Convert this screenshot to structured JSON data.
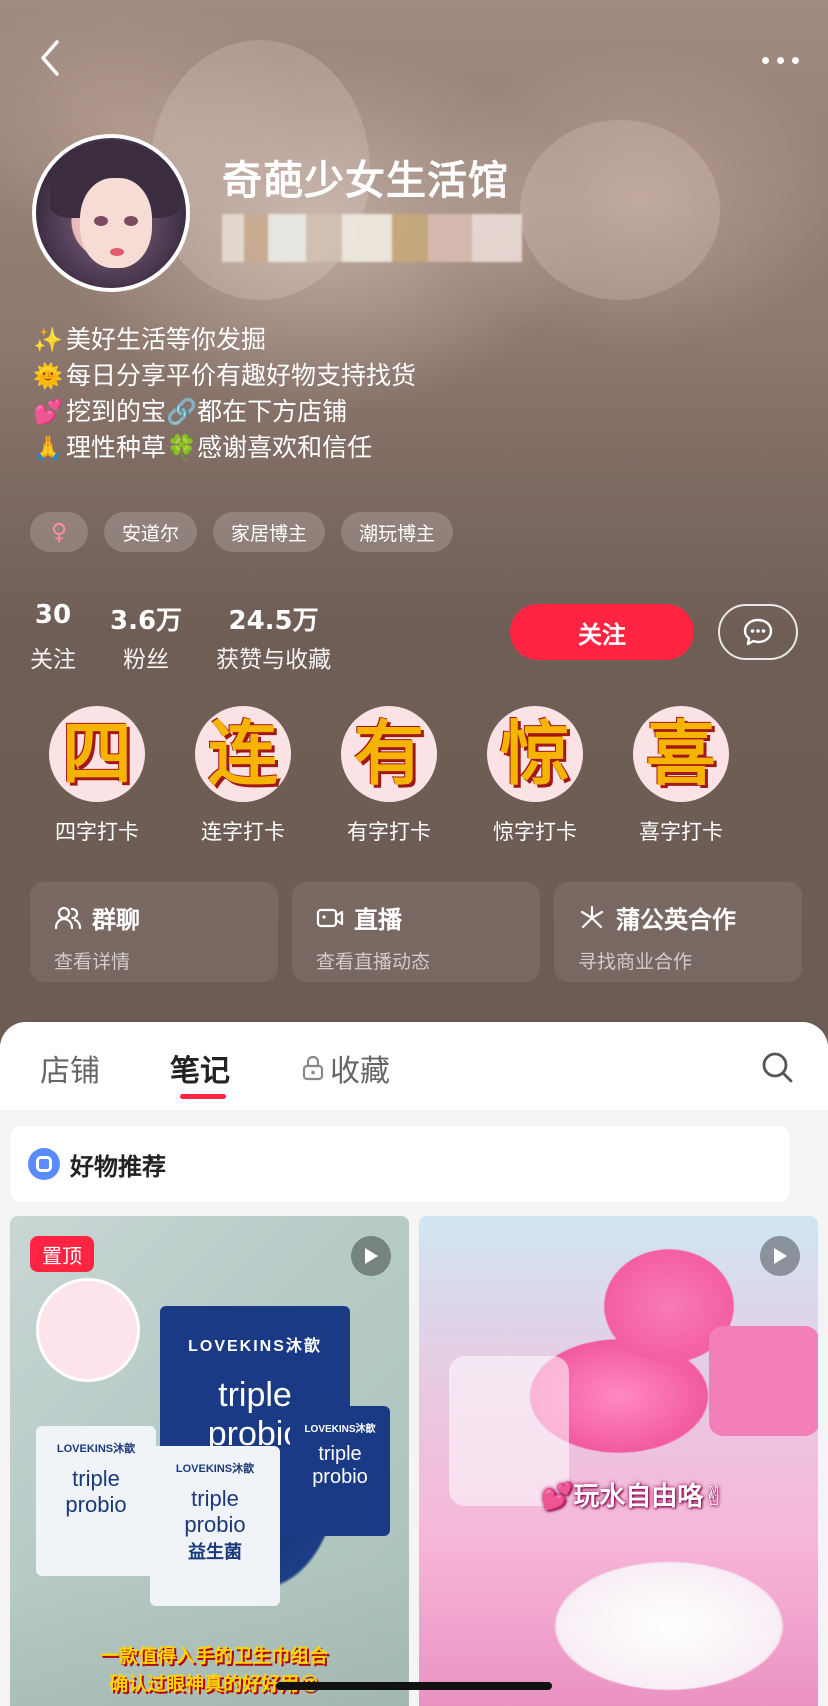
{
  "profile": {
    "nickname": "奇葩少女生活馆",
    "bio": [
      {
        "emoji": "✨",
        "text": "美好生活等你发掘"
      },
      {
        "emoji": "🌞",
        "text": "每日分享平价有趣好物支持找货"
      },
      {
        "emoji": "💕",
        "text": "挖到的宝🔗都在下方店铺"
      },
      {
        "emoji": "🙏",
        "text": "理性种草🍀感谢喜欢和信任"
      }
    ],
    "tags": [
      "♀",
      "安道尔",
      "家居博主",
      "潮玩博主"
    ]
  },
  "stats": [
    {
      "num": "30",
      "label": "关注"
    },
    {
      "num": "3.6万",
      "label": "粉丝"
    },
    {
      "num": "24.5万",
      "label": "获赞与收藏"
    }
  ],
  "actions": {
    "follow_label": "关注"
  },
  "checkins": [
    {
      "char": "四",
      "label": "四字打卡"
    },
    {
      "char": "连",
      "label": "连字打卡"
    },
    {
      "char": "有",
      "label": "有字打卡"
    },
    {
      "char": "惊",
      "label": "惊字打卡"
    },
    {
      "char": "喜",
      "label": "喜字打卡"
    }
  ],
  "cards": [
    {
      "title": "群聊",
      "sub": "查看详情",
      "icon": "group-icon"
    },
    {
      "title": "直播",
      "sub": "查看直播动态",
      "icon": "live-icon"
    },
    {
      "title": "蒲公英合作",
      "sub": "寻找商业合作",
      "icon": "dandelion-icon"
    }
  ],
  "tabs": [
    {
      "label": "店铺"
    },
    {
      "label": "笔记"
    },
    {
      "label": "收藏"
    }
  ],
  "recommend": {
    "label": "好物推荐"
  },
  "notes": [
    {
      "badge": "置顶",
      "pack_brand": "LOVEKINS沐歆",
      "pack_line1": "triple",
      "pack_line2": "probio",
      "pack_cn": "益生菌",
      "caption_line1": "一款值得入手的卫生巾组合",
      "caption_line2": "确认过眼神真的好好用😍"
    },
    {
      "caption": "💕玩水自由咯✌"
    }
  ],
  "colors": {
    "accent": "#ff2442",
    "header_bg": "#6d5c54"
  }
}
